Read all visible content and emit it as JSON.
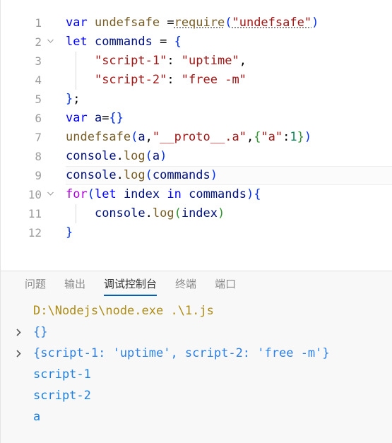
{
  "editor": {
    "language": "javascript",
    "active_line": 9,
    "lines": [
      {
        "number": "1",
        "fold": "",
        "indent_guides": 0,
        "tokens": [
          {
            "t": "var",
            "c": "t-kw"
          },
          {
            "t": " ",
            "c": "t-plain"
          },
          {
            "t": "undefsafe",
            "c": "t-fn"
          },
          {
            "t": " =",
            "c": "t-plain"
          },
          {
            "t": "require",
            "c": "t-fn squiggle"
          },
          {
            "t": "(",
            "c": "t-br-blue"
          },
          {
            "t": "\"undefsafe\"",
            "c": "t-str squiggle"
          },
          {
            "t": ")",
            "c": "t-br-blue"
          }
        ]
      },
      {
        "number": "2",
        "fold": "chevron-down-icon",
        "indent_guides": 0,
        "tokens": [
          {
            "t": "let",
            "c": "t-kw"
          },
          {
            "t": " ",
            "c": "t-plain"
          },
          {
            "t": "commands",
            "c": "t-var"
          },
          {
            "t": " ",
            "c": "t-plain"
          },
          {
            "t": "=",
            "c": "t-punc"
          },
          {
            "t": " ",
            "c": "t-plain"
          },
          {
            "t": "{",
            "c": "t-br-blue"
          }
        ]
      },
      {
        "number": "3",
        "fold": "",
        "indent_guides": 1,
        "tokens": [
          {
            "t": "    ",
            "c": "t-plain"
          },
          {
            "t": "\"script-1\"",
            "c": "t-str"
          },
          {
            "t": ": ",
            "c": "t-punc"
          },
          {
            "t": "\"uptime\"",
            "c": "t-str"
          },
          {
            "t": ",",
            "c": "t-punc"
          }
        ]
      },
      {
        "number": "4",
        "fold": "",
        "indent_guides": 1,
        "tokens": [
          {
            "t": "    ",
            "c": "t-plain"
          },
          {
            "t": "\"script-2\"",
            "c": "t-str"
          },
          {
            "t": ": ",
            "c": "t-punc"
          },
          {
            "t": "\"free -m\"",
            "c": "t-str"
          }
        ]
      },
      {
        "number": "5",
        "fold": "",
        "indent_guides": 0,
        "tokens": [
          {
            "t": "}",
            "c": "t-br-blue"
          },
          {
            "t": ";",
            "c": "t-punc"
          }
        ]
      },
      {
        "number": "6",
        "fold": "",
        "indent_guides": 0,
        "tokens": [
          {
            "t": "var",
            "c": "t-kw"
          },
          {
            "t": " ",
            "c": "t-plain"
          },
          {
            "t": "a",
            "c": "t-var"
          },
          {
            "t": "=",
            "c": "t-punc"
          },
          {
            "t": "{}",
            "c": "t-br-blue"
          }
        ]
      },
      {
        "number": "7",
        "fold": "",
        "indent_guides": 0,
        "tokens": [
          {
            "t": "undefsafe",
            "c": "t-fn"
          },
          {
            "t": "(",
            "c": "t-br-blue"
          },
          {
            "t": "a",
            "c": "t-var"
          },
          {
            "t": ",",
            "c": "t-punc"
          },
          {
            "t": "\"__proto__.a\"",
            "c": "t-str"
          },
          {
            "t": ",",
            "c": "t-punc"
          },
          {
            "t": "{",
            "c": "t-br-green"
          },
          {
            "t": "\"a\"",
            "c": "t-str"
          },
          {
            "t": ":",
            "c": "t-punc"
          },
          {
            "t": "1",
            "c": "t-num"
          },
          {
            "t": "}",
            "c": "t-br-green"
          },
          {
            "t": ")",
            "c": "t-br-blue"
          }
        ]
      },
      {
        "number": "8",
        "fold": "",
        "indent_guides": 0,
        "tokens": [
          {
            "t": "console",
            "c": "t-var"
          },
          {
            "t": ".",
            "c": "t-punc"
          },
          {
            "t": "log",
            "c": "t-fn"
          },
          {
            "t": "(",
            "c": "t-br-blue"
          },
          {
            "t": "a",
            "c": "t-var"
          },
          {
            "t": ")",
            "c": "t-br-blue"
          }
        ]
      },
      {
        "number": "9",
        "fold": "",
        "indent_guides": 0,
        "highlight": true,
        "tokens": [
          {
            "t": "console",
            "c": "t-var"
          },
          {
            "t": ".",
            "c": "t-punc"
          },
          {
            "t": "log",
            "c": "t-fn"
          },
          {
            "t": "(",
            "c": "t-br-blue"
          },
          {
            "t": "commands",
            "c": "t-var"
          },
          {
            "t": ")",
            "c": "t-br-blue"
          }
        ]
      },
      {
        "number": "10",
        "fold": "chevron-down-icon",
        "indent_guides": 0,
        "tokens": [
          {
            "t": "for",
            "c": "t-ctrl"
          },
          {
            "t": "(",
            "c": "t-br-blue"
          },
          {
            "t": "let",
            "c": "t-kw"
          },
          {
            "t": " ",
            "c": "t-plain"
          },
          {
            "t": "index",
            "c": "t-var"
          },
          {
            "t": " ",
            "c": "t-plain"
          },
          {
            "t": "in",
            "c": "t-kw"
          },
          {
            "t": " ",
            "c": "t-plain"
          },
          {
            "t": "commands",
            "c": "t-var"
          },
          {
            "t": ")",
            "c": "t-br-blue"
          },
          {
            "t": "{",
            "c": "t-br-blue"
          }
        ]
      },
      {
        "number": "11",
        "fold": "",
        "indent_guides": 1,
        "tokens": [
          {
            "t": "    ",
            "c": "t-plain"
          },
          {
            "t": "console",
            "c": "t-var"
          },
          {
            "t": ".",
            "c": "t-punc"
          },
          {
            "t": "log",
            "c": "t-fn"
          },
          {
            "t": "(",
            "c": "t-br-green"
          },
          {
            "t": "index",
            "c": "t-var"
          },
          {
            "t": ")",
            "c": "t-br-green"
          }
        ]
      },
      {
        "number": "12",
        "fold": "",
        "indent_guides": 0,
        "tokens": [
          {
            "t": "}",
            "c": "t-br-blue"
          }
        ]
      }
    ]
  },
  "panel": {
    "tabs": [
      {
        "label": "问题",
        "name": "tab-problems",
        "active": false
      },
      {
        "label": "输出",
        "name": "tab-output",
        "active": false
      },
      {
        "label": "调试控制台",
        "name": "tab-debug-console",
        "active": true
      },
      {
        "label": "终端",
        "name": "tab-terminal",
        "active": false
      },
      {
        "label": "端口",
        "name": "tab-ports",
        "active": false
      }
    ],
    "active_tab_accent": "#005fb8",
    "console": {
      "rows": [
        {
          "chevron": false,
          "name": "console-command-line",
          "segments": [
            {
              "t": "D:\\Nodejs\\node.exe .\\1.js",
              "c": "c-path"
            }
          ]
        },
        {
          "chevron": true,
          "name": "console-object-row",
          "segments": [
            {
              "t": "{}",
              "c": "c-blue"
            }
          ]
        },
        {
          "chevron": true,
          "name": "console-object-row",
          "segments": [
            {
              "t": "{script-1: 'uptime', script-2: 'free -m'}",
              "c": "c-blue"
            }
          ]
        },
        {
          "chevron": false,
          "name": "console-log-row",
          "segments": [
            {
              "t": "script-1",
              "c": "c-blue2"
            }
          ]
        },
        {
          "chevron": false,
          "name": "console-log-row",
          "segments": [
            {
              "t": "script-2",
              "c": "c-blue2"
            }
          ]
        },
        {
          "chevron": false,
          "name": "console-log-row",
          "segments": [
            {
              "t": "a",
              "c": "c-blue2"
            }
          ]
        }
      ]
    }
  }
}
